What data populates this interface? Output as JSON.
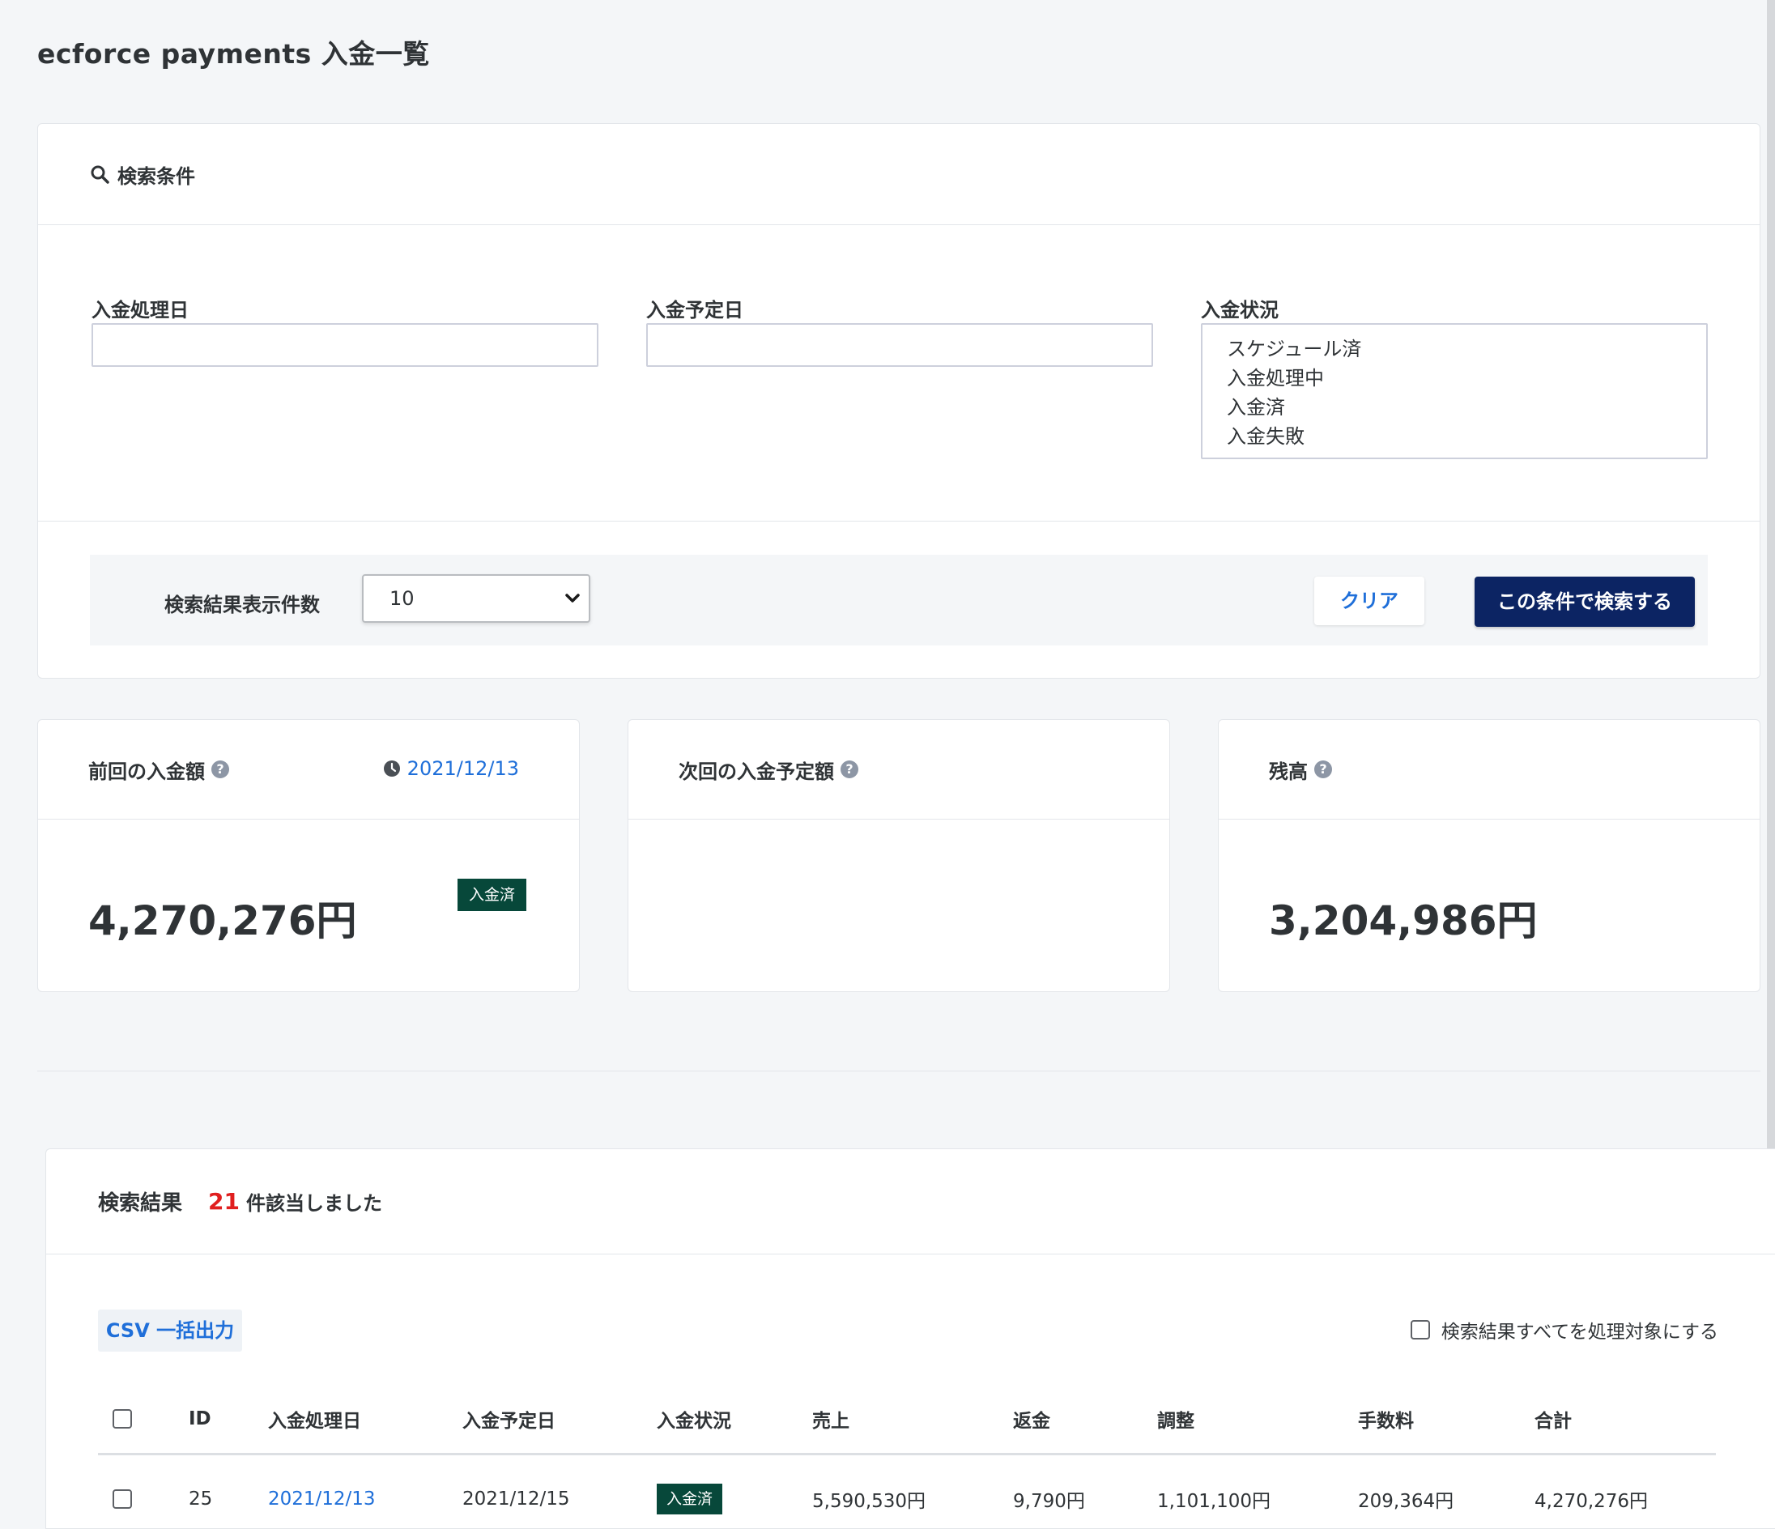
{
  "page": {
    "title": "ecforce payments 入金一覧"
  },
  "search": {
    "header": "検索条件",
    "fields": {
      "processed_date_label": "入金処理日",
      "scheduled_date_label": "入金予定日",
      "status_label": "入金状況",
      "status_options": [
        "スケジュール済",
        "入金処理中",
        "入金済",
        "入金失敗"
      ]
    },
    "per_page_label": "検索結果表示件数",
    "per_page_value": "10",
    "clear_label": "クリア",
    "submit_label": "この条件で検索する"
  },
  "stats": {
    "last": {
      "label": "前回の入金額",
      "date": "2021/12/13",
      "amount": "4,270,276円",
      "badge": "入金済"
    },
    "next": {
      "label": "次回の入金予定額"
    },
    "balance": {
      "label": "残高",
      "amount": "3,204,986円"
    }
  },
  "results": {
    "title": "検索結果",
    "count": "21",
    "count_suffix": "件該当しました",
    "csv_label": "CSV 一括出力",
    "select_all_label": "検索結果すべてを処理対象にする",
    "columns": [
      "ID",
      "入金処理日",
      "入金予定日",
      "入金状況",
      "売上",
      "返金",
      "調整",
      "手数料",
      "合計"
    ],
    "rows": [
      {
        "id": "25",
        "processed_date": "2021/12/13",
        "scheduled_date": "2021/12/15",
        "status": "入金済",
        "sales": "5,590,530円",
        "refund": "9,790円",
        "adjustment": "1,101,100円",
        "fee": "209,364円",
        "total": "4,270,276円"
      }
    ]
  },
  "colors": {
    "primary": "#0c2463",
    "link": "#1f6fd9",
    "badge_paid": "#07483a",
    "count": "#e01f1f",
    "background": "#f4f6f8"
  }
}
